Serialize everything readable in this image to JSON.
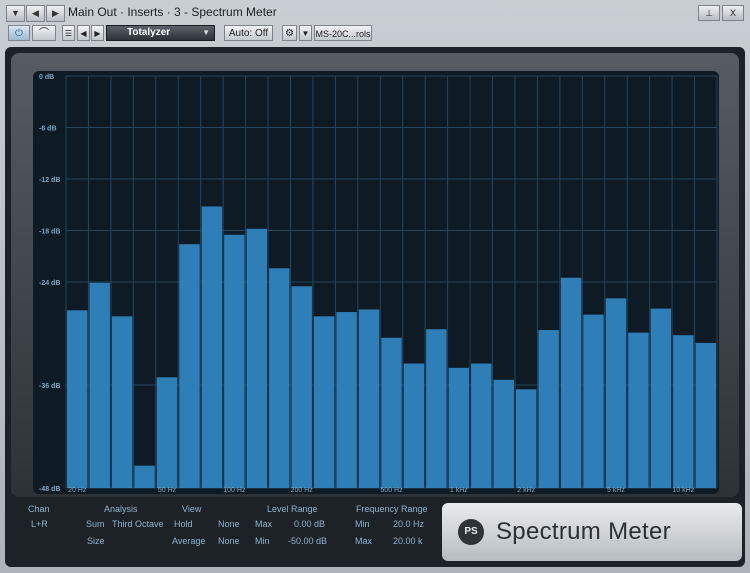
{
  "titlebar": {
    "title": "Main Out · Inserts · 3 - Spectrum Meter",
    "nav_down": "▼",
    "nav_prev": "◀",
    "nav_next": "▶",
    "pin": "⊥",
    "close": "X"
  },
  "toolbar": {
    "preset": "Totalyzer",
    "auto": "Auto: Off",
    "device": "MS-20C...rols"
  },
  "icons": {
    "power": "power-icon",
    "bypass": "bypass-icon",
    "list": "list-icon",
    "gear": "gear-icon",
    "dropdown": "chevron-down-icon"
  },
  "colors": {
    "bar": "#2e7fb8",
    "plot_bg": "#0e1b24",
    "grid": "#27455c",
    "axis_text": "#7fa6c3"
  },
  "chart_data": {
    "type": "bar",
    "ylim": [
      -48,
      0
    ],
    "y_ticks": [
      {
        "value": 0,
        "label": "0 dB"
      },
      {
        "value": -6,
        "label": "-6 dB"
      },
      {
        "value": -12,
        "label": "-12 dB"
      },
      {
        "value": -18,
        "label": "-18 dB"
      },
      {
        "value": -24,
        "label": "-24 dB"
      },
      {
        "value": -36,
        "label": "-36 dB"
      },
      {
        "value": -48,
        "label": "-48 dB"
      }
    ],
    "x_ticks": [
      {
        "band": 0,
        "label": "20 Hz"
      },
      {
        "band": 4,
        "label": "50 Hz"
      },
      {
        "band": 7,
        "label": "100 Hz"
      },
      {
        "band": 10,
        "label": "200 Hz"
      },
      {
        "band": 14,
        "label": "500 Hz"
      },
      {
        "band": 17,
        "label": "1 kHz"
      },
      {
        "band": 20,
        "label": "2 kHz"
      },
      {
        "band": 24,
        "label": "5 kHz"
      },
      {
        "band": 27,
        "label": "10 kHz"
      }
    ],
    "values": [
      -27.3,
      -24.1,
      -28.0,
      -45.4,
      -35.1,
      -19.6,
      -15.2,
      -18.5,
      -17.8,
      -22.4,
      -24.5,
      -28.0,
      -27.5,
      -27.2,
      -30.5,
      -33.5,
      -29.5,
      -34.0,
      -33.5,
      -35.4,
      -36.5,
      -29.6,
      -23.5,
      -27.8,
      -25.9,
      -29.9,
      -27.1,
      -30.2,
      -31.1
    ],
    "grid": true
  },
  "params": {
    "chan_header": "Chan",
    "chan_value": "L+R",
    "analysis_header": "Analysis",
    "analysis_sum": "Sum",
    "analysis_size": "Size",
    "analysis_mode": "Third Octave",
    "view_header": "View",
    "view_hold": "Hold",
    "view_hold_value": "None",
    "view_average": "Average",
    "view_average_value": "None",
    "level_header": "Level Range",
    "level_max_label": "Max",
    "level_max_value": "0.00 dB",
    "level_min_label": "Min",
    "level_min_value": "-50.00 dB",
    "freq_header": "Frequency Range",
    "freq_min_label": "Min",
    "freq_min_value": "20.0 Hz",
    "freq_max_label": "Max",
    "freq_max_value": "20.00 k"
  },
  "logo": {
    "mark": "PS",
    "name": "Spectrum Meter"
  }
}
